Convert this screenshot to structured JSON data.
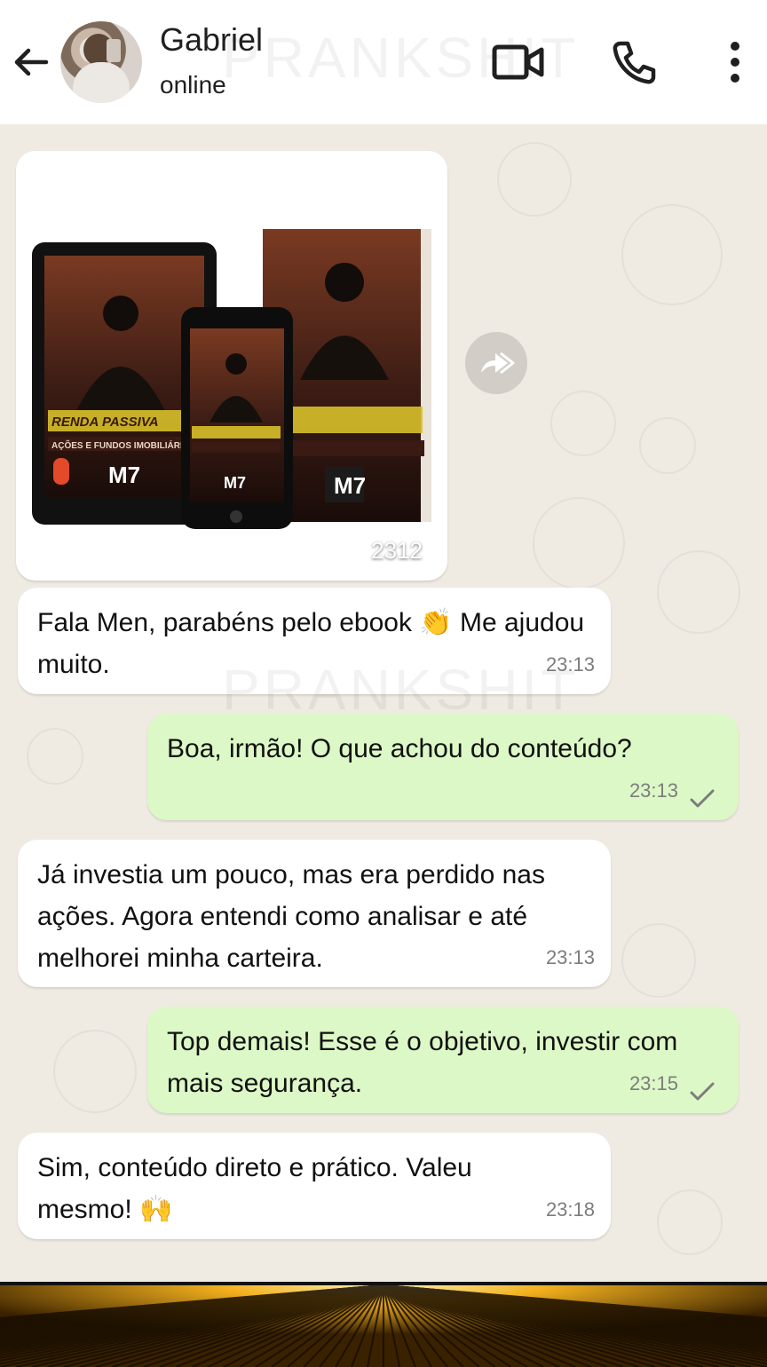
{
  "header": {
    "contact_name": "Gabriel",
    "status": "online",
    "watermark": "PRANKSHIT"
  },
  "icons": {
    "back": "arrow-left-icon",
    "avatar": "contact-avatar",
    "video_call": "video-camera-icon",
    "voice_call": "phone-icon",
    "menu": "kebab-menu-icon",
    "forward": "forward-icon",
    "read_tick": "check-icon"
  },
  "image_message": {
    "count_label": "2312",
    "promo_title": "RENDA PASSIVA",
    "promo_subtitle": "AÇÕES E FUNDOS IMOBILIÁRIOS",
    "promo_brand": "M7"
  },
  "messages": [
    {
      "direction": "in",
      "text": "Fala Men, parabéns pelo ebook 👏 Me ajudou muito.",
      "time": "23:13"
    },
    {
      "direction": "out",
      "text": "Boa, irmão! O que achou do conteúdo?",
      "time": "23:13"
    },
    {
      "direction": "in",
      "text": "Já investia um pouco, mas era perdido nas ações. Agora entendi como analisar e até melhorei minha carteira.",
      "time": "23:13"
    },
    {
      "direction": "out",
      "text": "Top demais! Esse é o objetivo, investir com mais segurança.",
      "time": "23:15"
    },
    {
      "direction": "in",
      "text": "Sim, conteúdo direto e prático. Valeu mesmo! 🙌",
      "time": "23:18"
    }
  ],
  "colors": {
    "incoming_bubble": "#ffffff",
    "outgoing_bubble": "#dcf8c6",
    "chat_background": "#efeae2",
    "banner_accent": "#f2b01e"
  }
}
